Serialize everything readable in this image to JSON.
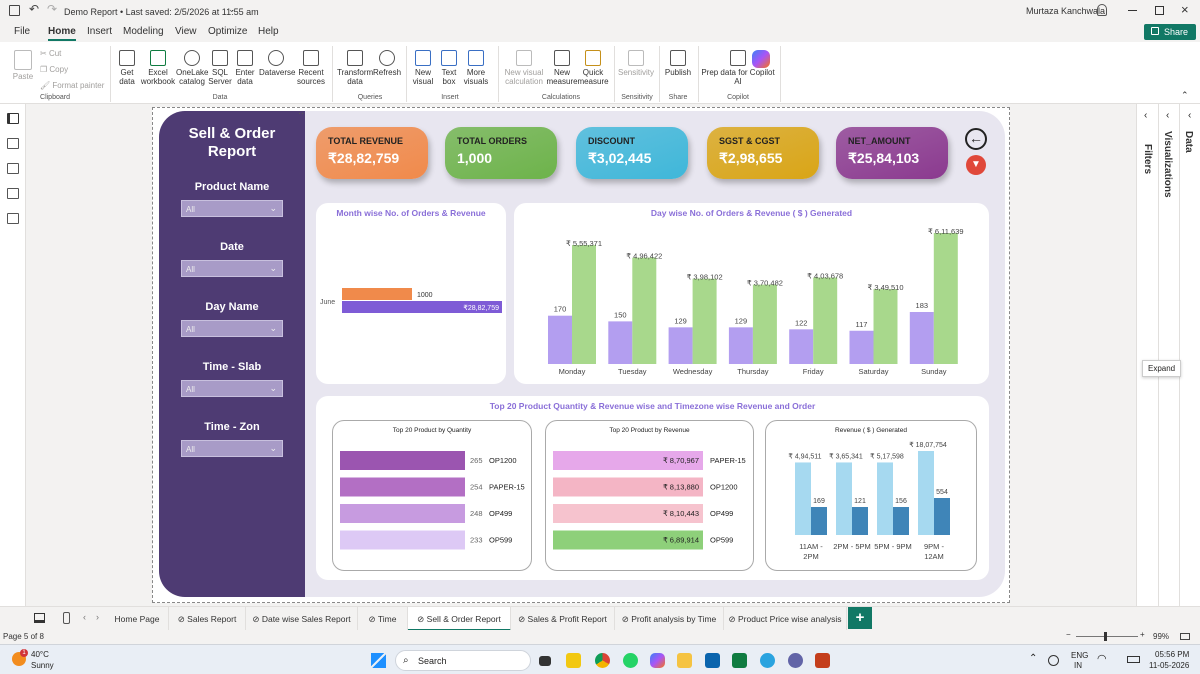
{
  "titlebar": {
    "title": "Demo Report • Last saved: 2/5/2026 at 11:55 am",
    "user": "Murtaza Kanchwala",
    "share": "Share"
  },
  "menu": [
    "File",
    "Home",
    "Insert",
    "Modeling",
    "View",
    "Optimize",
    "Help"
  ],
  "ribbon": {
    "clipboard": {
      "paste": "Paste",
      "cut": "Cut",
      "copy": "Copy",
      "format_painter": "Format painter",
      "group": "Clipboard"
    },
    "data": {
      "items": [
        "Get data",
        "Excel workbook",
        "OneLake catalog",
        "SQL Server",
        "Enter data",
        "Dataverse",
        "Recent sources"
      ],
      "group": "Data"
    },
    "queries": {
      "items": [
        "Transform data",
        "Refresh"
      ],
      "group": "Queries"
    },
    "insert": {
      "items": [
        "New visual",
        "Text box",
        "More visuals"
      ],
      "group": "Insert"
    },
    "calculations": {
      "items": [
        "New visual calculation",
        "New measure",
        "Quick measure"
      ],
      "group": "Calculations"
    },
    "sensitivity": {
      "items": [
        "Sensitivity"
      ],
      "group": "Sensitivity"
    },
    "share": {
      "items": [
        "Publish"
      ],
      "group": "Share"
    },
    "copilot": {
      "items": [
        "Prep data for Copilot AI"
      ],
      "group": "Copilot"
    }
  },
  "report": {
    "title": "Sell & Order Report",
    "slicers": [
      {
        "label": "Product Name",
        "value": "All"
      },
      {
        "label": "Date",
        "value": "All"
      },
      {
        "label": "Day Name",
        "value": "All"
      },
      {
        "label": "Time - Slab",
        "value": "All"
      },
      {
        "label": "Time - Zon",
        "value": "All"
      }
    ],
    "kpis": [
      {
        "label": "TOTAL REVENUE",
        "value": "₹28,82,759",
        "color": "#f08a4b"
      },
      {
        "label": "TOTAL ORDERS",
        "value": "1,000",
        "color": "#6db34a"
      },
      {
        "label": "DISCOUNT",
        "value": "₹3,02,445",
        "color": "#3fb7d9"
      },
      {
        "label": "SGST & CGST",
        "value": "₹2,98,655",
        "color": "#d9a516"
      },
      {
        "label": "NET_AMOUNT",
        "value": "₹25,84,103",
        "color": "#8b3a8f"
      }
    ]
  },
  "chart_data": [
    {
      "type": "bar",
      "orientation": "horizontal",
      "title": "Month wise No. of Orders & Revenue",
      "categories": [
        "June"
      ],
      "series": [
        {
          "name": "Orders",
          "values": [
            1000
          ],
          "labels": [
            "1000"
          ],
          "color": "#f08a4b"
        },
        {
          "name": "Revenue",
          "values": [
            2882759
          ],
          "labels": [
            "₹28,82,759"
          ],
          "color": "#7e5bd6"
        }
      ]
    },
    {
      "type": "bar",
      "title": "Day wise No. of Orders & Revenue ( $ ) Generated",
      "categories": [
        "Monday",
        "Tuesday",
        "Wednesday",
        "Thursday",
        "Friday",
        "Saturday",
        "Sunday"
      ],
      "series": [
        {
          "name": "Orders",
          "values": [
            170,
            150,
            129,
            129,
            122,
            117,
            183
          ],
          "labels": [
            "170",
            "150",
            "129",
            "129",
            "122",
            "117",
            "183"
          ],
          "color": "#b39ef0"
        },
        {
          "name": "Revenue",
          "values": [
            555371,
            496422,
            398102,
            370482,
            403678,
            349510,
            611639
          ],
          "labels": [
            "₹ 5,55,371",
            "₹ 4,96,422",
            "₹ 3,98,102",
            "₹ 3,70,482",
            "₹ 4,03,678",
            "₹ 3,49,510",
            "₹ 6,11,639"
          ],
          "color": "#a8d88c"
        }
      ]
    },
    {
      "type": "bar",
      "orientation": "horizontal",
      "title": "Top 20 Product by Quantity",
      "categories": [
        "OP1200",
        "PAPER-15",
        "OP499",
        "OP599"
      ],
      "values": [
        265,
        254,
        248,
        233
      ],
      "labels": [
        "265",
        "254",
        "248",
        "233"
      ],
      "colors": [
        "#9b55b0",
        "#b36fc4",
        "#c79be0",
        "#ddc9f5"
      ]
    },
    {
      "type": "bar",
      "orientation": "horizontal",
      "title": "Top 20 Product by Revenue",
      "categories": [
        "PAPER-15",
        "OP1200",
        "OP499",
        "OP599"
      ],
      "values": [
        870967,
        813880,
        810443,
        689914
      ],
      "labels": [
        "₹ 8,70,967",
        "₹ 8,13,880",
        "₹ 8,10,443",
        "₹ 6,89,914"
      ],
      "colors": [
        "#e6a8ea",
        "#f4b5c5",
        "#f6c3ce",
        "#8ed07a"
      ]
    },
    {
      "type": "bar",
      "title": "Revenue ( $ ) Generated",
      "categories": [
        "11AM - 2PM",
        "2PM - 5PM",
        "5PM - 9PM",
        "9PM - 12AM"
      ],
      "series": [
        {
          "name": "Revenue",
          "values": [
            494511,
            365341,
            517598,
            1807754
          ],
          "labels": [
            "₹ 4,94,511",
            "₹ 3,65,341",
            "₹ 5,17,598",
            "₹ 18,07,754"
          ],
          "color": "#a6d9f0"
        },
        {
          "name": "Orders",
          "values": [
            169,
            121,
            156,
            554
          ],
          "labels": [
            "169",
            "121",
            "156",
            "554"
          ],
          "color": "#3f85b8"
        }
      ]
    }
  ],
  "section_title": "Top 20 Product Quantity & Revenue wise and Timezone wise Revenue and Order",
  "panes": {
    "filters": "Filters",
    "visualizations": "Visualizations",
    "data": "Data",
    "expand": "Expand"
  },
  "tabs": [
    "Home Page",
    "Sales Report",
    "Date wise Sales Report",
    "Time",
    "Sell & Order Report",
    "Sales & Profit Report",
    "Profit analysis by Time",
    "Product Price wise analysis"
  ],
  "active_tab": "Sell & Order Report",
  "status": {
    "page": "Page 5 of 8",
    "zoom": "99%"
  },
  "taskbar": {
    "weather_temp": "40°C",
    "weather_desc": "Sunny",
    "search": "Search",
    "lang1": "ENG",
    "lang2": "IN",
    "time": "05:56 PM",
    "date": "11-05-2026"
  }
}
